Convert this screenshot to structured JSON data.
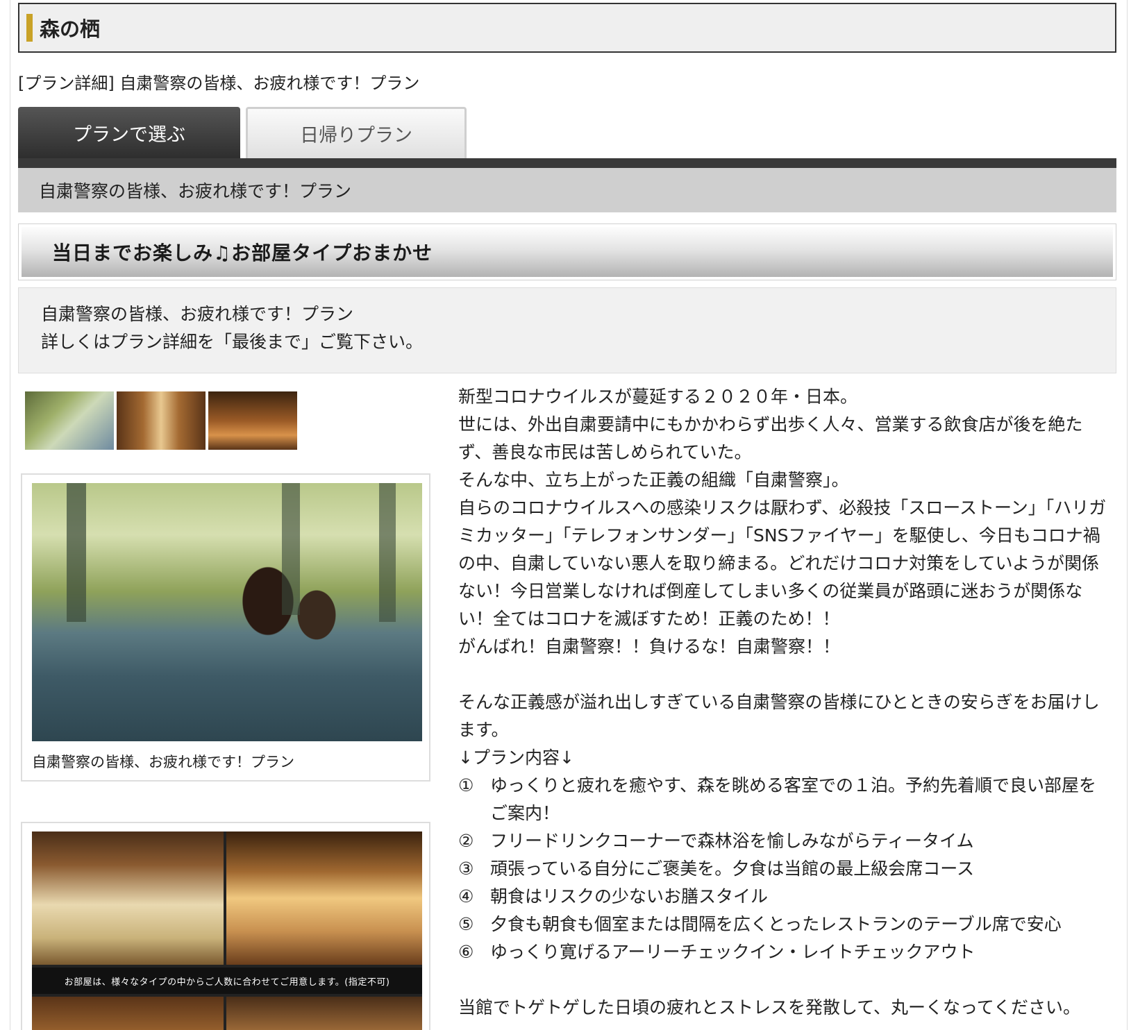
{
  "header": {
    "hotel_name": "森の栖"
  },
  "breadcrumb": "[プラン詳細] 自粛警察の皆様、お疲れ様です！プラン",
  "tabs": [
    {
      "label": "プランで選ぶ",
      "active": true
    },
    {
      "label": "日帰りプラン",
      "active": false
    }
  ],
  "plan": {
    "title": "自粛警察の皆様、お疲れ様です！プラン",
    "banner": "当日までお楽しみ♫お部屋タイプおまかせ",
    "summary_line1": "自粛警察の皆様、お疲れ様です！プラン",
    "summary_line2": "詳しくはプラン詳細を「最後まで」ご覧下さい。"
  },
  "gallery": {
    "main_caption": "自粛警察の皆様、お疲れ様です！プラン",
    "room_note": "お部屋は、様々なタイプの中からご人数に合わせてご用意します。(指定不可)"
  },
  "description": {
    "paragraphs": [
      "新型コロナウイルスが蔓延する２０２０年・日本。",
      "世には、外出自粛要請中にもかかわらず出歩く人々、営業する飲食店が後を絶たず、善良な市民は苦しめられていた。",
      "そんな中、立ち上がった正義の組織「自粛警察」。",
      "自らのコロナウイルスへの感染リスクは厭わず、必殺技「スローストーン」「ハリガミカッター」「テレフォンサンダー」「SNSファイヤー」を駆使し、今日もコロナ禍の中、自粛していない悪人を取り締まる。どれだけコロナ対策をしていようが関係ない！今日営業しなければ倒産してしまい多くの従業員が路頭に迷おうが関係ない！全てはコロナを滅ぼすため！正義のため！！",
      "がんばれ！自粛警察！！負けるな！自粛警察！！"
    ],
    "intro": "そんな正義感が溢れ出しすぎている自粛警察の皆様にひとときの安らぎをお届けします。",
    "list_heading": "↓プラン内容↓",
    "items": [
      {
        "num": "①",
        "text": "ゆっくりと疲れを癒やす、森を眺める客室での１泊。予約先着順で良い部屋をご案内！"
      },
      {
        "num": "②",
        "text": "フリードリンクコーナーで森林浴を愉しみながらティータイム"
      },
      {
        "num": "③",
        "text": "頑張っている自分にご褒美を。夕食は当館の最上級会席コース"
      },
      {
        "num": "④",
        "text": "朝食はリスクの少ないお膳スタイル"
      },
      {
        "num": "⑤",
        "text": "夕食も朝食も個室または間隔を広くとったレストランのテーブル席で安心"
      },
      {
        "num": "⑥",
        "text": "ゆっくり寛げるアーリーチェックイン・レイトチェックアウト"
      }
    ],
    "closing": "当館でトゲトゲした日頃の疲れとストレスを発散して、丸ーくなってください。"
  }
}
